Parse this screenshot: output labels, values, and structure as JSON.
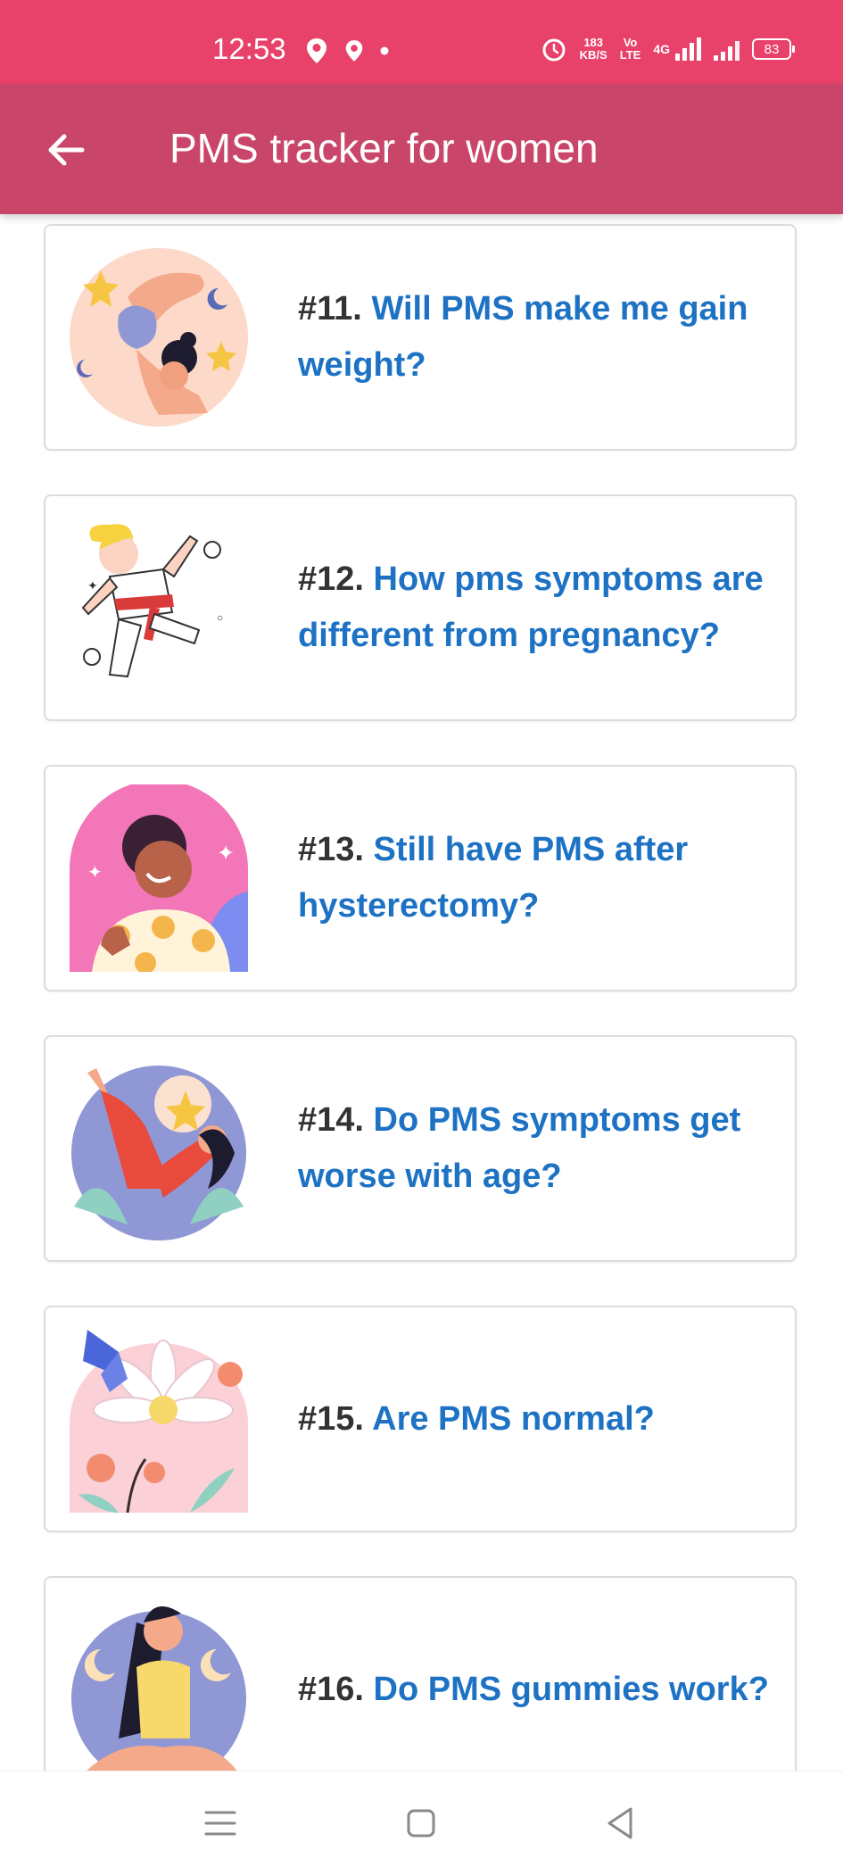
{
  "status_bar": {
    "time": "12:53",
    "speed_value": "183",
    "speed_unit": "KB/S",
    "volte_top": "Vo",
    "volte_bottom": "LTE",
    "network": "4G",
    "battery": "83",
    "icons": [
      "location-icon",
      "location-icon",
      "dot-icon",
      "alarm-icon",
      "signal-icon",
      "signal-icon",
      "battery-icon"
    ]
  },
  "app_bar": {
    "title": "PMS tracker for women",
    "back_icon": "arrow-left-icon"
  },
  "articles": [
    {
      "number": "#11.",
      "question": "Will PMS make me gain weight?"
    },
    {
      "number": "#12.",
      "question": "How pms symptoms are different from pregnancy?"
    },
    {
      "number": "#13.",
      "question": "Still have PMS after hysterectomy?"
    },
    {
      "number": "#14.",
      "question": "Do PMS symptoms get worse with age?"
    },
    {
      "number": "#15.",
      "question": "Are PMS normal?"
    },
    {
      "number": "#16.",
      "question": "Do PMS gummies work?"
    }
  ],
  "nav_bar": {
    "icons": [
      "menu-icon",
      "home-square-icon",
      "back-triangle-icon"
    ]
  },
  "colors": {
    "status_bar": "#e8416a",
    "app_bar": "#c9466a",
    "question_text": "#1d72c4",
    "number_text": "#333333"
  }
}
